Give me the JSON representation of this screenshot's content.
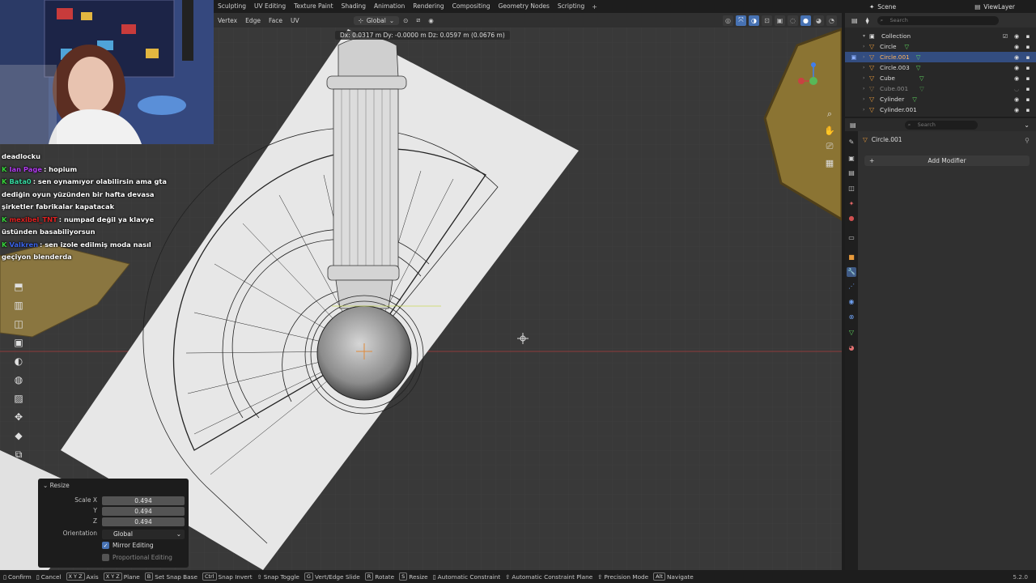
{
  "workspace_tabs": [
    "Sculpting",
    "UV Editing",
    "Texture Paint",
    "Shading",
    "Animation",
    "Rendering",
    "Compositing",
    "Geometry Nodes",
    "Scripting"
  ],
  "view_header": {
    "select_modes": [
      "Vertex",
      "Edge",
      "Face"
    ],
    "uv_menu": "UV",
    "orientation": "Global"
  },
  "transform_readout": "Dx: 0.0317 m  Dy: -0.0000 m  Dz: 0.0597 m (0.0676 m)",
  "chat": [
    {
      "user": "",
      "text": "deadlocku",
      "color": "#ffffff"
    },
    {
      "user": "Ian Page",
      "text": ": hopium",
      "color": "#b23cf0"
    },
    {
      "user": "Bata0",
      "text": ": sen oynamıyor olabilirsin ama gta dediğin oyun yüzünden bir hafta devasa şirketler fabrikalar kapatacak",
      "color": "#36d9a0"
    },
    {
      "user": "mexibel_TNT",
      "text": ": numpad değil ya klavye üstünden basabiliyorsun",
      "color": "#e02020"
    },
    {
      "user": "Valkren",
      "text": ": sen izole edilmiş moda nasıl geçiyon blenderda",
      "color": "#3a63e8"
    }
  ],
  "resize_panel": {
    "title": "Resize",
    "scale_x_label": "Scale X",
    "y_label": "Y",
    "z_label": "Z",
    "scale_x": "0.494",
    "scale_y": "0.494",
    "scale_z": "0.494",
    "orientation_label": "Orientation",
    "orientation_value": "Global",
    "mirror_editing": "Mirror Editing",
    "proportional_editing": "Proportional Editing"
  },
  "top_right": {
    "scene": "Scene",
    "view_layer": "ViewLayer",
    "search_placeholder": "Search"
  },
  "outliner": {
    "collection": "Collection",
    "items": [
      {
        "name": "Circle",
        "selected": false,
        "dim": false
      },
      {
        "name": "Circle.001",
        "selected": true,
        "dim": false
      },
      {
        "name": "Circle.003",
        "selected": false,
        "dim": false
      },
      {
        "name": "Cube",
        "selected": false,
        "dim": false
      },
      {
        "name": "Cube.001",
        "selected": false,
        "dim": true
      },
      {
        "name": "Cylinder",
        "selected": false,
        "dim": false
      },
      {
        "name": "Cylinder.001",
        "selected": false,
        "dim": false
      }
    ]
  },
  "properties": {
    "search_placeholder": "Search",
    "object_name": "Circle.001",
    "add_modifier": "Add Modifier"
  },
  "statusbar": [
    {
      "key": "",
      "label": "Confirm"
    },
    {
      "key": "",
      "label": "Cancel"
    },
    {
      "key": "X Y Z",
      "label": "Axis"
    },
    {
      "key": "X Y Z",
      "label": "Plane"
    },
    {
      "key": "B",
      "label": "Set Snap Base"
    },
    {
      "key": "Ctrl",
      "label": "Snap Invert"
    },
    {
      "key": "",
      "label": "Snap Toggle"
    },
    {
      "key": "G",
      "label": "Vert/Edge Slide"
    },
    {
      "key": "R",
      "label": "Rotate"
    },
    {
      "key": "S",
      "label": "Resize"
    },
    {
      "key": "",
      "label": "Automatic Constraint"
    },
    {
      "key": "",
      "label": "Automatic Constraint Plane"
    },
    {
      "key": "",
      "label": "Precision Mode"
    },
    {
      "key": "Alt",
      "label": "Navigate"
    }
  ],
  "version": "5.2.0",
  "colors": {
    "accent": "#4772b3",
    "object_orange": "#e89a3b",
    "mesh_green": "#5fd65f",
    "x_axis_red": "#c84242"
  }
}
